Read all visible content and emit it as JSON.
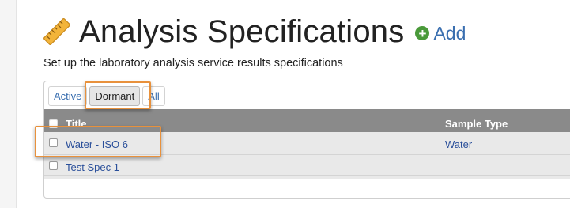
{
  "page": {
    "title": "Analysis Specifications",
    "add_label": "Add",
    "description": "Set up the laboratory analysis service results specifications"
  },
  "filters": {
    "active_label": "Active",
    "dormant_label": "Dormant",
    "all_label": "All",
    "selected": "Dormant"
  },
  "table": {
    "columns": {
      "title": "Title",
      "sample_type": "Sample Type"
    },
    "rows": [
      {
        "title": "Water - ISO 6",
        "sample_type": "Water"
      },
      {
        "title": "Test Spec 1",
        "sample_type": ""
      }
    ]
  },
  "colors": {
    "link": "#3a6fb0",
    "header_bg": "#8a8a8a",
    "row_bg": "#e9e9e9",
    "highlight": "#e8913c",
    "add_icon": "#4a9a3a"
  },
  "icons": [
    "ruler-icon",
    "add-icon",
    "checkbox"
  ]
}
